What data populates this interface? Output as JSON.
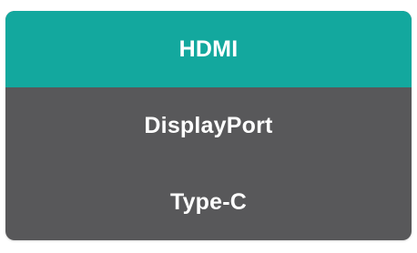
{
  "input_menu": {
    "selected_index": 0,
    "items": [
      {
        "label": "HDMI",
        "selected": true
      },
      {
        "label": "DisplayPort",
        "selected": false
      },
      {
        "label": "Type-C",
        "selected": false
      }
    ]
  },
  "colors": {
    "background": "#58585a",
    "selected": "#13a89e",
    "text": "#ffffff"
  }
}
